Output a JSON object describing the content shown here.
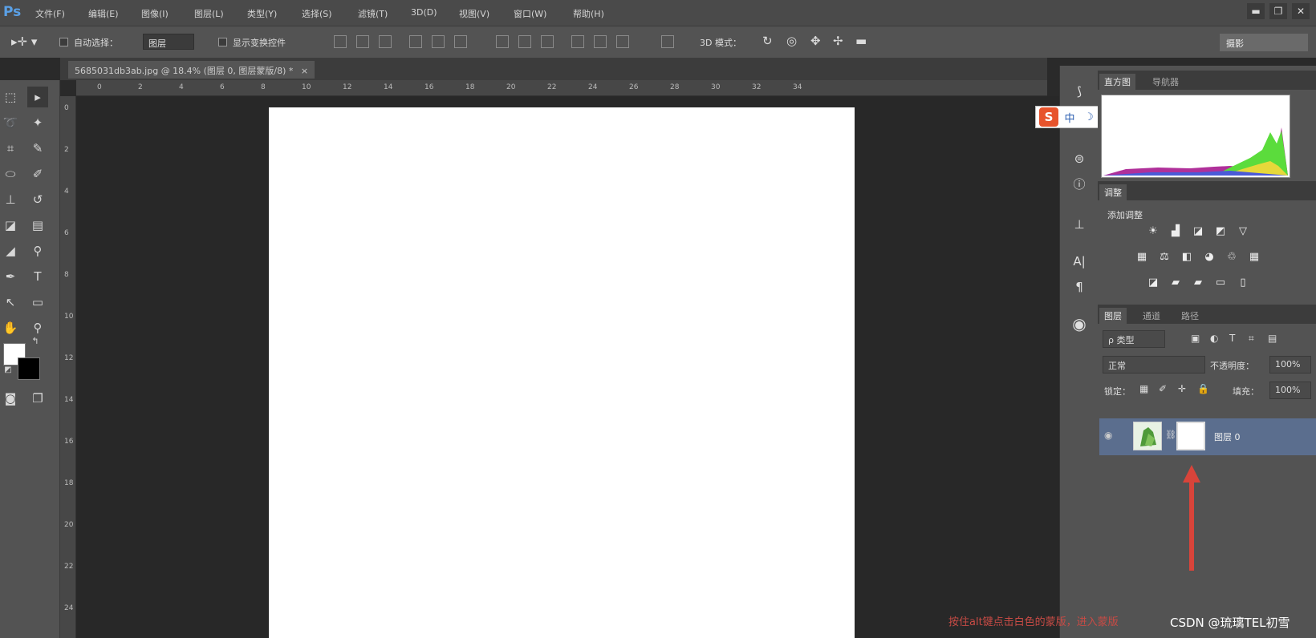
{
  "app": {
    "logo": "Ps"
  },
  "menu": [
    "文件(F)",
    "编辑(E)",
    "图像(I)",
    "图层(L)",
    "类型(Y)",
    "选择(S)",
    "滤镜(T)",
    "3D(D)",
    "视图(V)",
    "窗口(W)",
    "帮助(H)"
  ],
  "window_controls": {
    "minimize": "▬",
    "restore": "❐",
    "close": "✕"
  },
  "options": {
    "auto_select_label": "自动选择：",
    "auto_select_value": "图层",
    "show_transform_label": "显示变换控件",
    "mode_3d_label": "3D 模式：",
    "workspace_label": "摄影"
  },
  "document": {
    "tab_label": "5685031db3ab.jpg @ 18.4% (图层 0, 图层蒙版/8) *",
    "tab_close": "×"
  },
  "ruler_h": [
    "0",
    "2",
    "4",
    "6",
    "8",
    "10",
    "12",
    "14",
    "16",
    "18",
    "20",
    "22",
    "24",
    "26",
    "28",
    "30",
    "32",
    "34"
  ],
  "ruler_v": [
    "0",
    "2",
    "4",
    "6",
    "8",
    "10",
    "12",
    "14",
    "16",
    "18",
    "20",
    "22",
    "24"
  ],
  "toolbar": {
    "icons": [
      "marquee-icon",
      "move-icon",
      "lasso-icon",
      "magic-wand-icon",
      "crop-icon",
      "eyedropper-icon",
      "healing-icon",
      "brush-icon",
      "stamp-icon",
      "history-brush-icon",
      "eraser-icon",
      "gradient-icon",
      "blur-icon",
      "dodge-icon",
      "pen-icon",
      "type-icon",
      "path-select-icon",
      "shape-icon",
      "hand-icon",
      "zoom-icon"
    ],
    "foreground_color": "#ffffff",
    "background_color": "#000000"
  },
  "ime": {
    "logo": "S",
    "items": [
      "中",
      "☽",
      "°,",
      "🎤",
      "⌨",
      "👤",
      "👕",
      "🔧"
    ]
  },
  "panels": {
    "histogram": {
      "tabs": [
        "直方图",
        "导航器"
      ]
    },
    "adjustments": {
      "tabs": [
        "调整"
      ],
      "title": "添加调整"
    },
    "layers": {
      "tabs": [
        "图层",
        "通道",
        "路径"
      ],
      "filter_kind": "ρ 类型",
      "blend_mode": "正常",
      "opacity_label": "不透明度：",
      "opacity_value": "100%",
      "lock_label": "锁定：",
      "fill_label": "填充：",
      "fill_value": "100%",
      "layer_name": "图层 0"
    }
  },
  "annotation": "按住alt键点击白色的蒙版，进入蒙版",
  "credit": "CSDN @琉璃TEL初雪"
}
